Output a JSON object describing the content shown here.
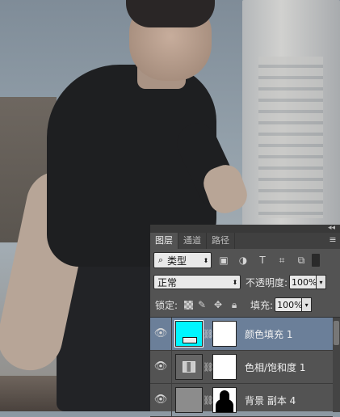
{
  "panel": {
    "collapse_glyph": "◂◂",
    "menu_glyph": "≡",
    "tabs": [
      {
        "label": "图层",
        "active": true
      },
      {
        "label": "通道",
        "active": false
      },
      {
        "label": "路径",
        "active": false
      }
    ],
    "filter": {
      "kind_label": "类型",
      "icons": [
        "image-filter-icon",
        "adjustment-filter-icon",
        "type-filter-icon",
        "shape-filter-icon",
        "smart-object-filter-icon"
      ]
    },
    "blend_mode": "正常",
    "opacity_label": "不透明度:",
    "opacity_value": "100%",
    "lock_label": "锁定:",
    "fill_label": "填充:",
    "fill_value": "100%",
    "layers": [
      {
        "name": "颜色填充 1",
        "type": "fill",
        "color": "#00f6ff",
        "selected": true
      },
      {
        "name": "色相/饱和度 1",
        "type": "adjustment",
        "selected": false
      },
      {
        "name": "背景 副本 4",
        "type": "pixel",
        "selected": false
      }
    ]
  },
  "colors": {
    "panel_bg": "#535353",
    "selection": "#6b7f99",
    "fill_swatch": "#00f6ff"
  }
}
